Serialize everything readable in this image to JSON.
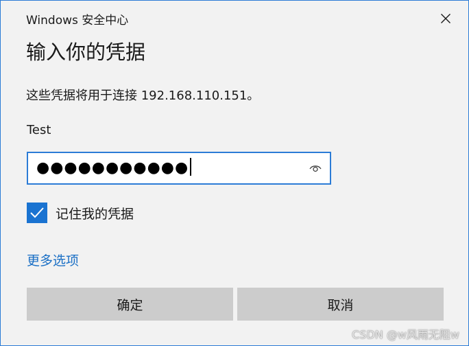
{
  "window": {
    "title": "Windows 安全中心",
    "close_icon": "close-icon",
    "accent_color": "#2b7bd6"
  },
  "dialog": {
    "heading": "输入你的凭据",
    "message": "这些凭据将用于连接 192.168.110.151。",
    "username": "Test",
    "password": {
      "masked_value": "●●●●●●●●●●●",
      "reveal_icon": "eye-icon"
    },
    "remember": {
      "label": "记住我的凭据",
      "checked": true,
      "check_icon": "checkmark-icon"
    },
    "more_options_label": "更多选项",
    "buttons": {
      "ok_label": "确定",
      "cancel_label": "取消"
    }
  },
  "watermark": "CSDN @w风雨无阻w"
}
